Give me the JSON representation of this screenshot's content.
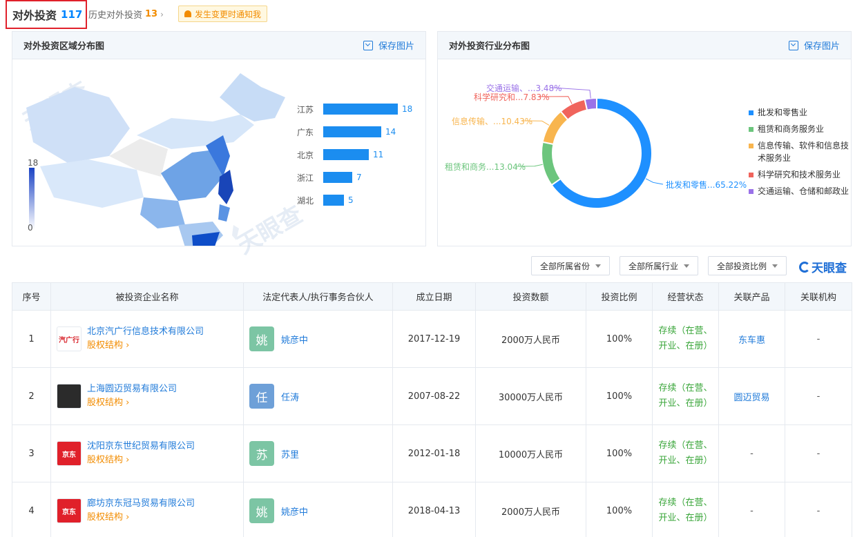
{
  "tabs": {
    "active_label": "对外投资",
    "active_count": "117",
    "history_label": "历史对外投资",
    "history_count": "13",
    "notify_label": "发生变更时通知我"
  },
  "region_panel": {
    "title": "对外投资区域分布图",
    "save_label": "保存图片",
    "scale_max": "18",
    "scale_min": "0"
  },
  "industry_panel": {
    "title": "对外投资行业分布图",
    "save_label": "保存图片",
    "slice_labels": [
      "交通运输、...3.48%",
      "科学研究和...7.83%",
      "信息传输、...10.43%",
      "租赁和商务...13.04%",
      "批发和零售...65.22%"
    ],
    "legend": [
      {
        "label": "批发和零售业",
        "color": "#1e90ff"
      },
      {
        "label": "租赁和商务服务业",
        "color": "#6cc57d"
      },
      {
        "label": "信息传输、软件和信息技术服务业",
        "color": "#f8b54e"
      },
      {
        "label": "科学研究和技术服务业",
        "color": "#f0645c"
      },
      {
        "label": "交通运输、仓储和邮政业",
        "color": "#9a72e8"
      }
    ]
  },
  "chart_data": [
    {
      "type": "bar",
      "categories": [
        "江苏",
        "广东",
        "北京",
        "浙江",
        "湖北"
      ],
      "values": [
        18,
        14,
        11,
        7,
        5
      ]
    },
    {
      "type": "pie",
      "categories": [
        "批发和零售业",
        "租赁和商务服务业",
        "信息传输、软件和信息技术服务业",
        "科学研究和技术服务业",
        "交通运输、仓储和邮政业"
      ],
      "values": [
        65.22,
        13.04,
        10.43,
        7.83,
        3.48
      ]
    }
  ],
  "filters": {
    "province": "全部所属省份",
    "industry": "全部所属行业",
    "ratio": "全部投资比例"
  },
  "brand": "天眼查",
  "table": {
    "headers": [
      "序号",
      "被投资企业名称",
      "法定代表人/执行事务合伙人",
      "成立日期",
      "投资数额",
      "投资比例",
      "经营状态",
      "关联产品",
      "关联机构"
    ],
    "equity_label": "股权结构",
    "rows": [
      {
        "no": "1",
        "logo_text": "汽广行",
        "company": "北京汽广行信息技术有限公司",
        "avatar": "姚",
        "person": "姚彦中",
        "date": "2017-12-19",
        "amount": "2000万人民币",
        "ratio": "100%",
        "status": "存续（在营、开业、在册）",
        "product": "东车惠",
        "org": "-"
      },
      {
        "no": "2",
        "logo_text": "",
        "company": "上海圆迈贸易有限公司",
        "avatar": "任",
        "person": "任涛",
        "date": "2007-08-22",
        "amount": "30000万人民币",
        "ratio": "100%",
        "status": "存续（在营、开业、在册）",
        "product": "圆迈贸易",
        "org": "-"
      },
      {
        "no": "3",
        "logo_text": "京东",
        "company": "沈阳京东世纪贸易有限公司",
        "avatar": "苏",
        "person": "苏里",
        "date": "2012-01-18",
        "amount": "10000万人民币",
        "ratio": "100%",
        "status": "存续（在营、开业、在册）",
        "product": "-",
        "org": "-"
      },
      {
        "no": "4",
        "logo_text": "京东",
        "company": "廊坊京东冠马贸易有限公司",
        "avatar": "姚",
        "person": "姚彦中",
        "date": "2018-04-13",
        "amount": "2000万人民币",
        "ratio": "100%",
        "status": "存续（在营、开业、在册）",
        "product": "-",
        "org": "-"
      }
    ]
  }
}
